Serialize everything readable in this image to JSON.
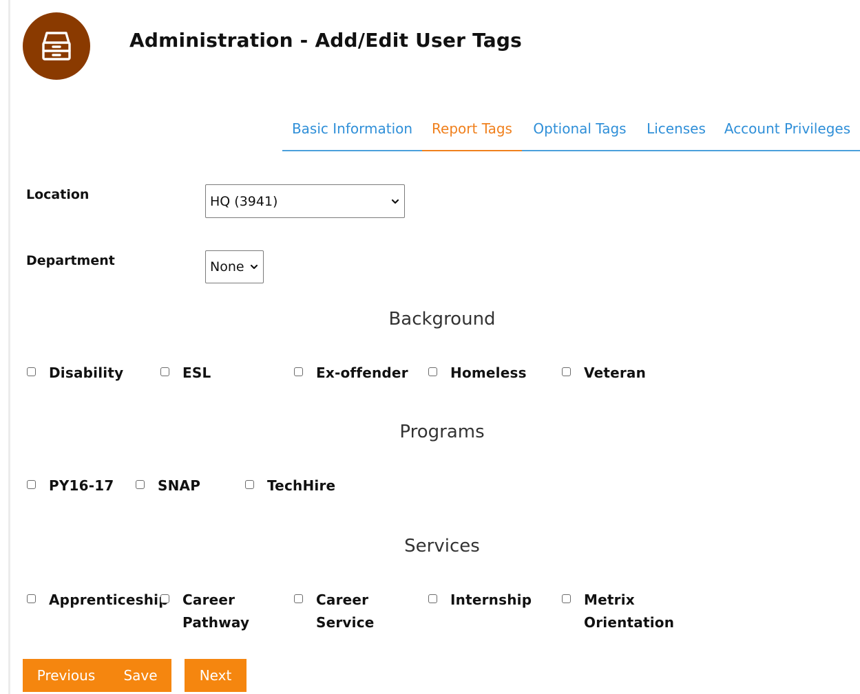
{
  "header": {
    "title": "Administration - Add/Edit User Tags",
    "logo_icon": "archive-drawer-icon"
  },
  "tabs": [
    {
      "label": "Basic Information",
      "active": false
    },
    {
      "label": "Report Tags",
      "active": true
    },
    {
      "label": "Optional Tags",
      "active": false
    },
    {
      "label": "Licenses",
      "active": false
    },
    {
      "label": "Account Privileges",
      "active": false
    }
  ],
  "form": {
    "location": {
      "label": "Location",
      "value": "HQ (3941)"
    },
    "department": {
      "label": "Department",
      "value": "None"
    }
  },
  "sections": {
    "background": {
      "title": "Background",
      "items": [
        "Disability",
        "ESL",
        "Ex-offender",
        "Homeless",
        "Veteran"
      ]
    },
    "programs": {
      "title": "Programs",
      "items": [
        "PY16-17",
        "SNAP",
        "TechHire"
      ]
    },
    "services": {
      "title": "Services",
      "items": [
        [
          "Apprenticeship"
        ],
        [
          "Career",
          "Pathway"
        ],
        [
          "Career",
          "Service"
        ],
        [
          "Internship"
        ],
        [
          "Metrix",
          "Orientation"
        ]
      ]
    }
  },
  "buttons": {
    "previous": "Previous",
    "save": "Save",
    "next": "Next"
  },
  "colors": {
    "accent": "#f5860f",
    "tab_link": "#2f8fd8",
    "tab_active": "#f0801d",
    "logo_bg": "#8a3a00"
  }
}
